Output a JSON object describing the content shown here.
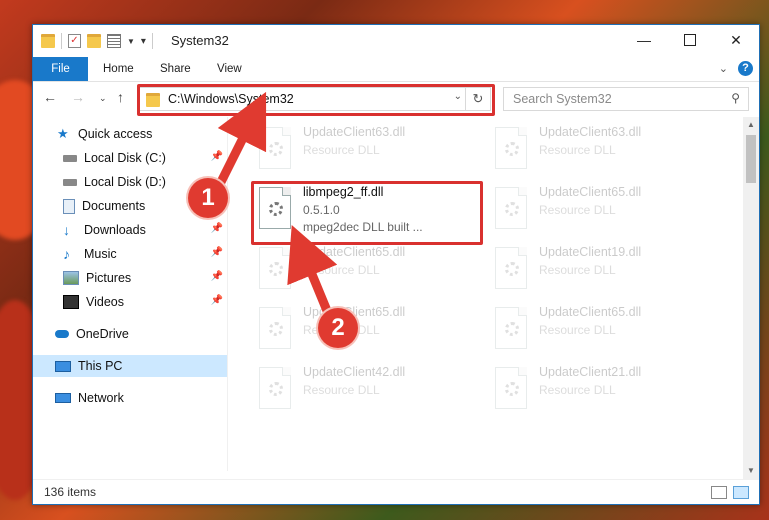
{
  "window": {
    "title": "System32",
    "controls": [
      "minimize-icon",
      "maximize-icon",
      "close-icon"
    ]
  },
  "ribbon": {
    "tabs": [
      "File",
      "Home",
      "Share",
      "View"
    ]
  },
  "address_bar": {
    "path": "C:\\Windows\\System32"
  },
  "search": {
    "placeholder": "Search System32"
  },
  "sidebar": {
    "items": [
      {
        "label": "Quick access",
        "icon": "star-icon"
      },
      {
        "label": "Local Disk (C:)",
        "icon": "drive-icon",
        "pinned": true
      },
      {
        "label": "Local Disk (D:)",
        "icon": "drive-icon"
      },
      {
        "label": "Documents",
        "icon": "documents-icon",
        "pinned": true
      },
      {
        "label": "Downloads",
        "icon": "download-icon",
        "pinned": true
      },
      {
        "label": "Music",
        "icon": "music-icon",
        "pinned": true
      },
      {
        "label": "Pictures",
        "icon": "pictures-icon",
        "pinned": true
      },
      {
        "label": "Videos",
        "icon": "videos-icon",
        "pinned": true
      },
      {
        "label": "OneDrive",
        "icon": "cloud-icon"
      },
      {
        "label": "This PC",
        "icon": "computer-icon",
        "selected": true
      },
      {
        "label": "Network",
        "icon": "network-icon"
      }
    ]
  },
  "files": [
    {
      "name": "UpdateClient63.dll",
      "line2": "Resource DLL",
      "line3": "",
      "faded": true
    },
    {
      "name": "UpdateClient63.dll",
      "line2": "Resource DLL",
      "line3": "",
      "faded": true
    },
    {
      "name": "libmpeg2_ff.dll",
      "line2": "0.5.1.0",
      "line3": "mpeg2dec DLL built ...",
      "faded": false
    },
    {
      "name": "UpdateClient65.dll",
      "line2": "Resource DLL",
      "line3": "",
      "faded": true
    },
    {
      "name": "UpdateClient65.dll",
      "line2": "Resource DLL",
      "line3": "",
      "faded": true
    },
    {
      "name": "UpdateClient19.dll",
      "line2": "Resource DLL",
      "line3": "",
      "faded": true
    },
    {
      "name": "UpdateClient65.dll",
      "line2": "Resource DLL",
      "line3": "",
      "faded": true
    },
    {
      "name": "UpdateClient65.dll",
      "line2": "Resource DLL",
      "line3": "",
      "faded": true
    },
    {
      "name": "UpdateClient42.dll",
      "line2": "Resource DLL",
      "line3": "",
      "faded": true
    },
    {
      "name": "UpdateClient21.dll",
      "line2": "Resource DLL",
      "line3": "",
      "faded": true
    }
  ],
  "status": {
    "item_count": "136 items"
  },
  "callouts": [
    "1",
    "2"
  ],
  "colors": {
    "accent": "#1979ca",
    "highlight": "#d9312f",
    "selection": "#cce8ff"
  }
}
